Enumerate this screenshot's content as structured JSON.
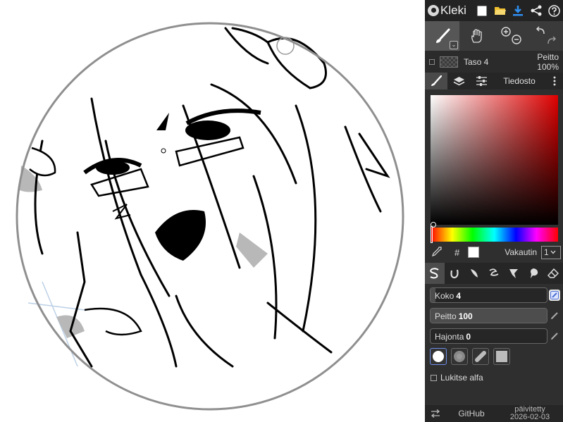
{
  "app": {
    "logo_text": "Kleki"
  },
  "topbar": {
    "icons": [
      "new-file-icon",
      "open-folder-icon",
      "download-icon",
      "share-icon",
      "help-icon"
    ],
    "accent": "#2f8ff0"
  },
  "tools": {
    "items": [
      "brush-tool-icon",
      "hand-tool-icon",
      "zoom-in-icon",
      "zoom-out-icon",
      "undo-icon",
      "redo-icon"
    ]
  },
  "layer": {
    "name": "Taso 4",
    "opacity_label": "Peitto",
    "opacity_value": "100%"
  },
  "tabs": {
    "files_label": "Tiedosto"
  },
  "color": {
    "hash_label": "#",
    "stabilizer_label": "Vakautin",
    "stabilizer_value": "1",
    "current_color": "#ffffff",
    "hue_color": "#e00000"
  },
  "brush_settings": {
    "size_label": "Koko",
    "size_value": "4",
    "size_fraction": 0.04,
    "opacity_label": "Peitto",
    "opacity_value": "100",
    "opacity_fraction": 1.0,
    "scatter_label": "Hajonta",
    "scatter_value": "0",
    "scatter_fraction": 0.0,
    "lock_alpha_label": "Lukitse alfa"
  },
  "footer": {
    "github_label": "GitHub",
    "updated_label": "päivitetty",
    "updated_date": "2026-02-03"
  }
}
